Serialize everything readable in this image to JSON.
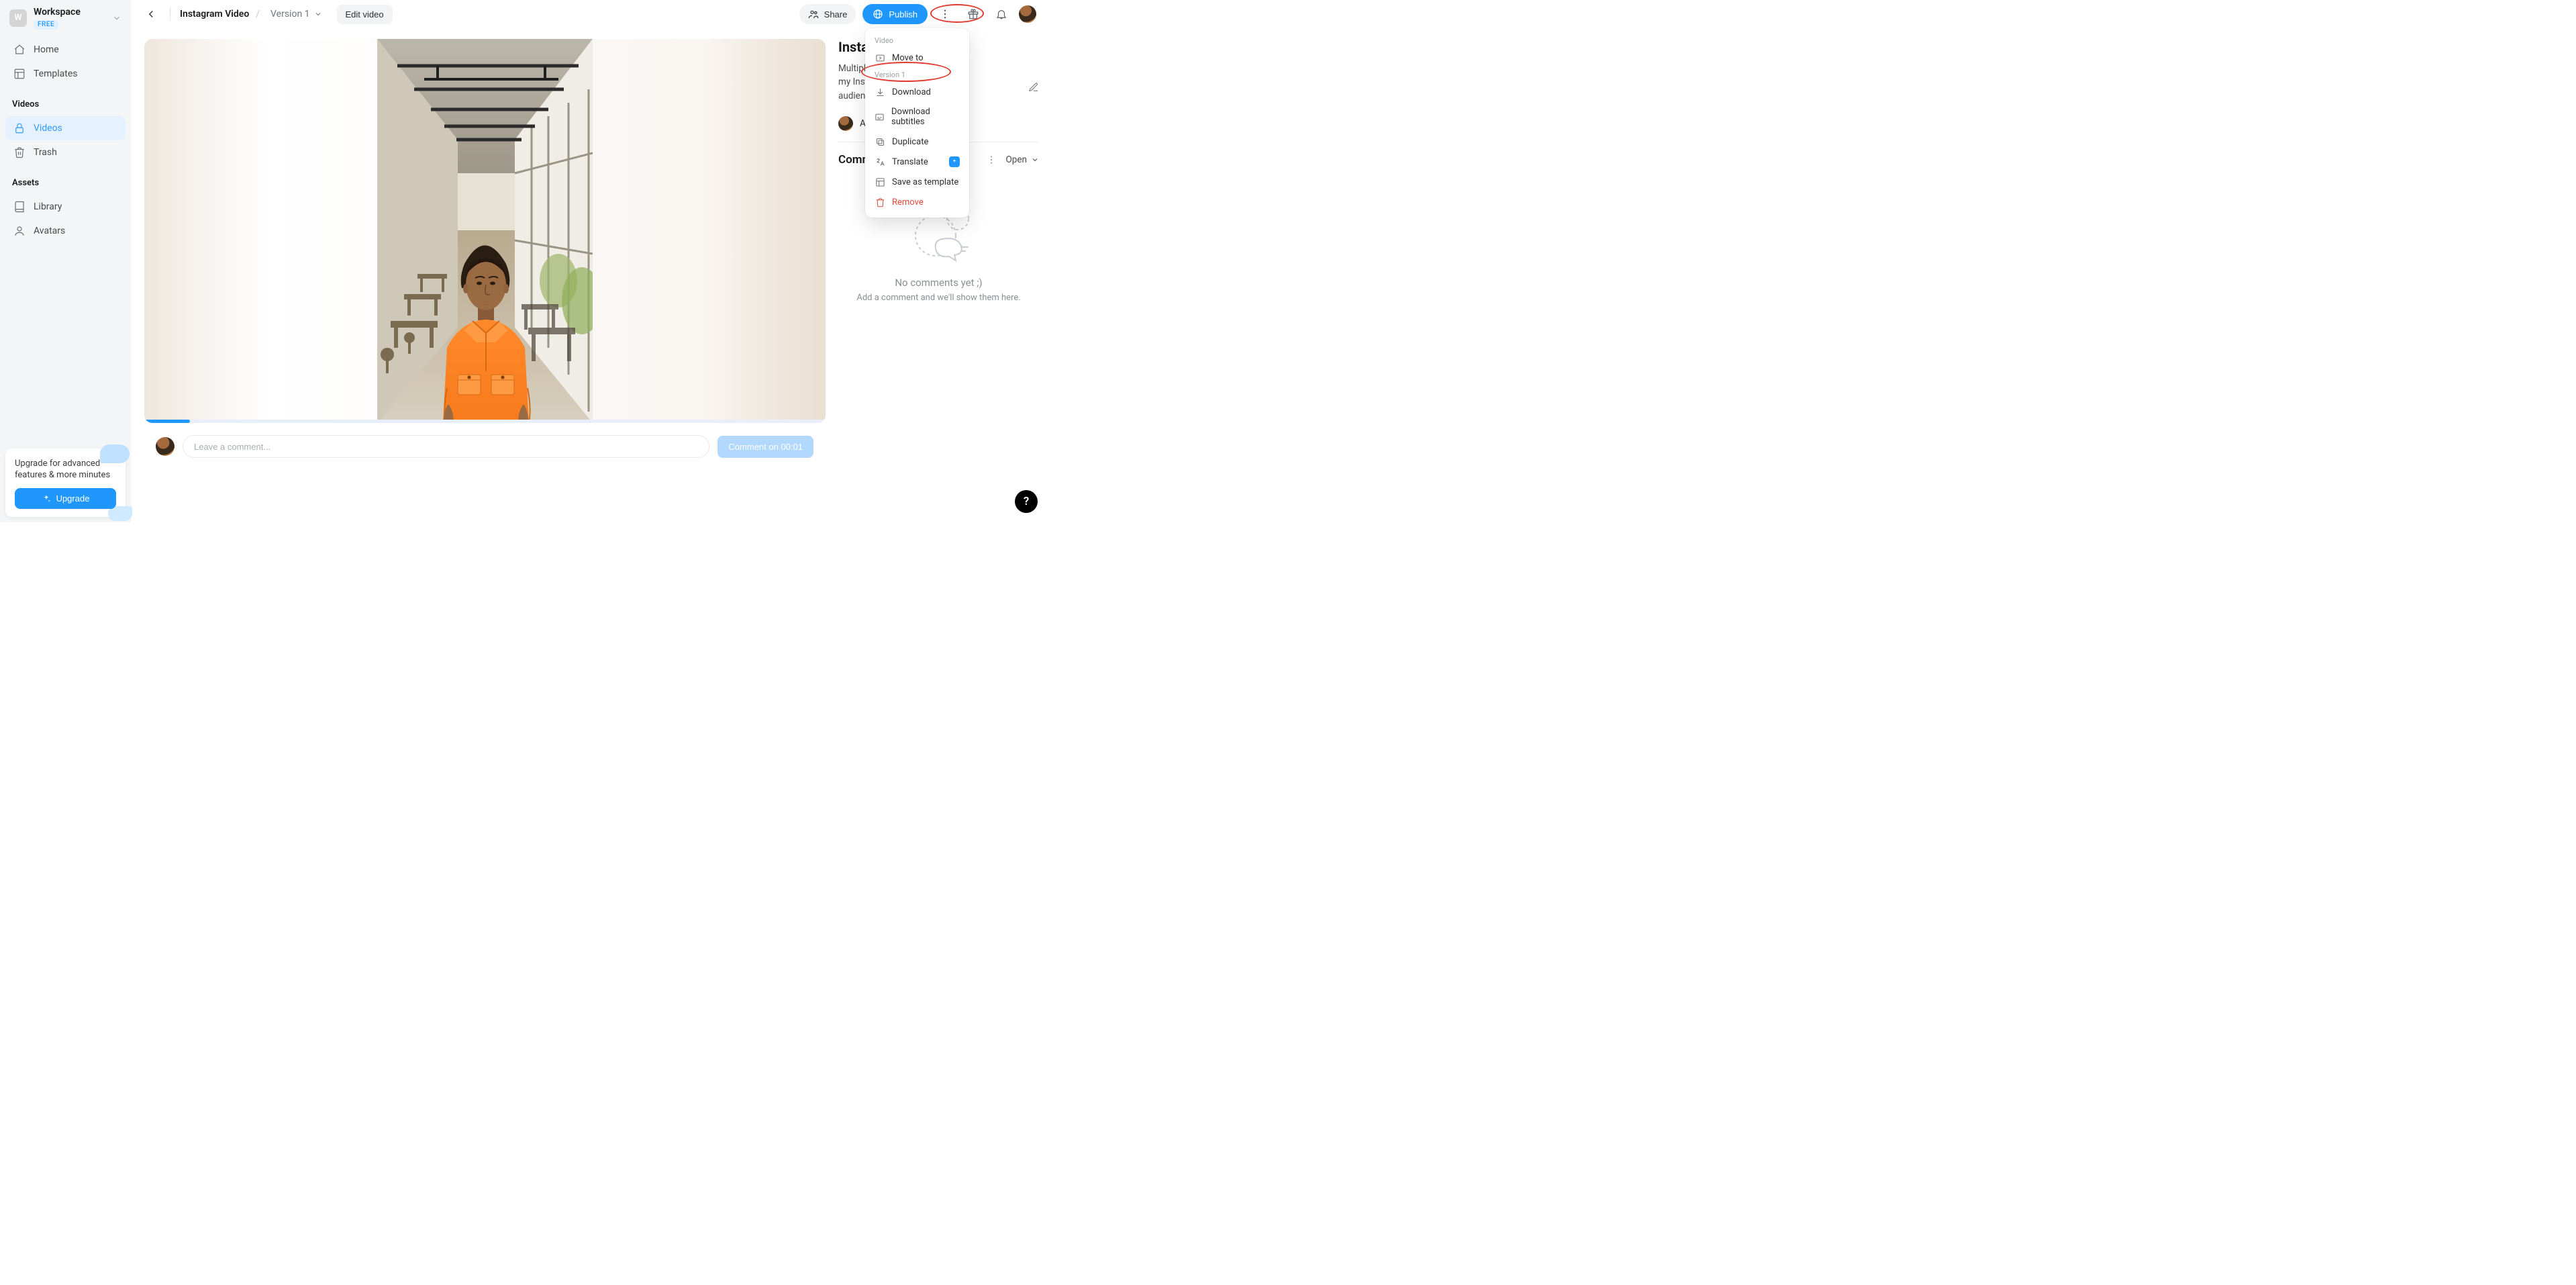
{
  "workspace": {
    "initial": "W",
    "name": "Workspace",
    "plan": "FREE"
  },
  "sidebar": {
    "nav": [
      {
        "label": "Home"
      },
      {
        "label": "Templates"
      }
    ],
    "sections": {
      "videos_header": "Videos",
      "videos_items": [
        {
          "label": "Videos"
        },
        {
          "label": "Trash"
        }
      ],
      "assets_header": "Assets",
      "assets_items": [
        {
          "label": "Library"
        },
        {
          "label": "Avatars"
        }
      ]
    },
    "upgrade": {
      "text": "Upgrade for advanced features & more minutes",
      "button": "Upgrade"
    }
  },
  "topbar": {
    "title": "Instagram Video",
    "version_label": "Version 1",
    "edit_label": "Edit video",
    "share_label": "Share",
    "publish_label": "Publish"
  },
  "info": {
    "title_visible": "Insta",
    "desc_line1_prefix": "Multiple",
    "desc_line1_suffix": "my Instagram",
    "desc_line2_prefix": "audienc",
    "author_prefix": "Ais"
  },
  "comments": {
    "header_visible": "Comme",
    "dropdown_label": "Open",
    "empty_title": "No comments yet ;)",
    "empty_sub": "Add a comment and we'll show them here."
  },
  "comment_input": {
    "placeholder": "Leave a comment...",
    "button": "Comment on 00:01"
  },
  "menu": {
    "group1": "Video",
    "move_to": "Move to",
    "group2": "Version 1",
    "download": "Download",
    "download_subtitles": "Download subtitles",
    "duplicate": "Duplicate",
    "translate": "Translate",
    "save_template": "Save as template",
    "remove": "Remove"
  },
  "help": {
    "label": "?"
  }
}
